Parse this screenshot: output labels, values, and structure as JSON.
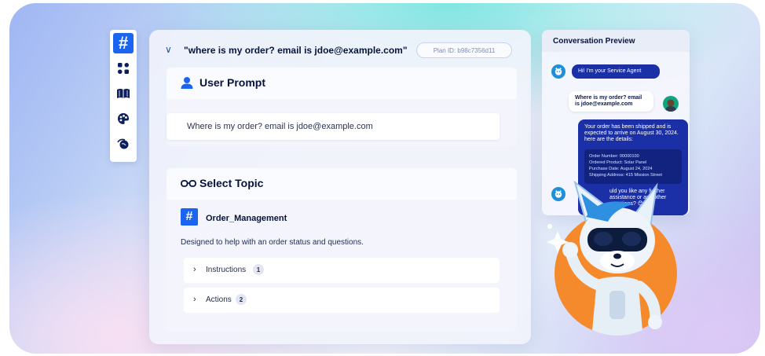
{
  "rail": {
    "items": [
      {
        "icon": "hash-icon",
        "glyph": "#",
        "active": true
      },
      {
        "icon": "grid-icon",
        "active": false
      },
      {
        "icon": "book-icon",
        "active": false
      },
      {
        "icon": "palette-icon",
        "active": false
      },
      {
        "icon": "planet-icon",
        "active": false
      }
    ]
  },
  "main": {
    "query": "\"where is my order? email is jdoe@example.com\"",
    "plan_id": "Plan ID: b98c7356d11",
    "user_prompt": {
      "title": "User Prompt",
      "text": "Where is my order? email is jdoe@example.com"
    },
    "select_topic": {
      "title": "Select Topic",
      "topic_glyph": "#",
      "topic_name": "Order_Management",
      "description": "Designed to help with an order status and questions.",
      "rows": [
        {
          "label": "Instructions",
          "count": "1"
        },
        {
          "label": "Actions",
          "count": "2"
        }
      ]
    }
  },
  "conversation": {
    "title": "Conversation Preview",
    "agent_greeting": "Hi! I'm your Service Agent",
    "user_message": "Where is my order? email is jdoe@example.com",
    "agent_reply_intro": "Your order has been shipped and is expected to arrive on August 30, 2024. here are the details:",
    "order_details": [
      "Order Number: 00000100",
      "Ordered Product: Solar Panel",
      "Purchase Date: August 24, 2024",
      "Shipping Address: 415 Mission Street"
    ],
    "agent_reply_outro": "uld you like any further assistance or any other questions? 😊"
  },
  "colors": {
    "accent": "#1b64f0",
    "agent_bubble": "#1b2fa6",
    "text_dark": "#07143b"
  }
}
